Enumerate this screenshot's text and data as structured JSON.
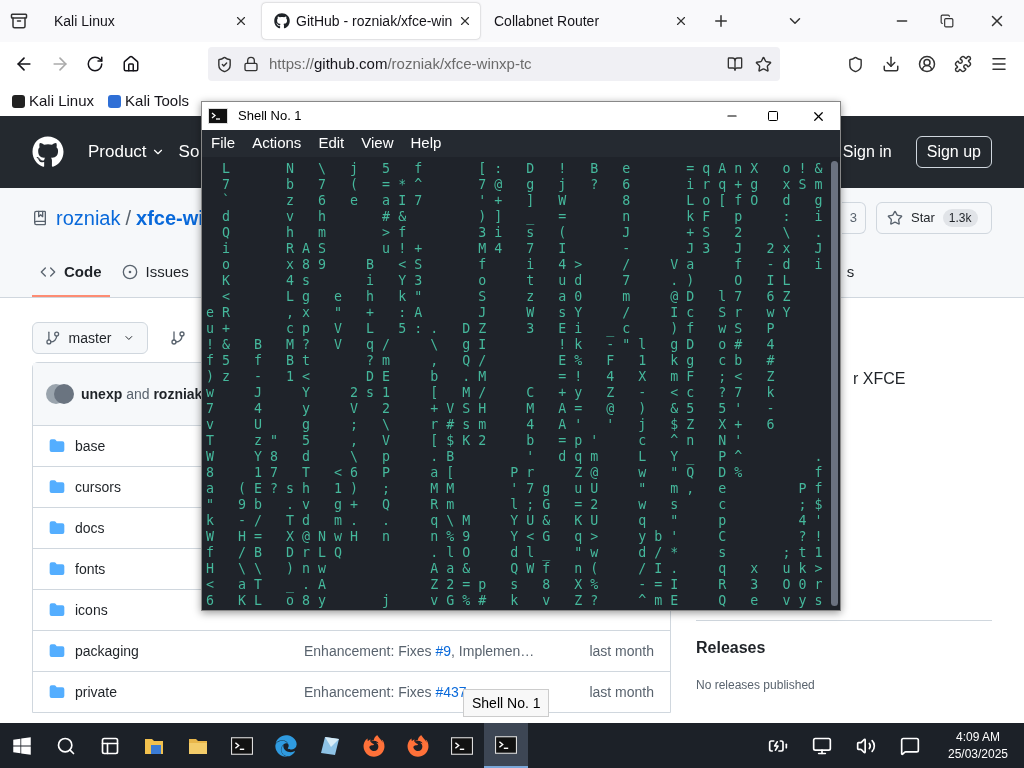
{
  "browser": {
    "tabs": [
      {
        "title": "Kali Linux",
        "selected": false,
        "kind": "plain"
      },
      {
        "title": "GitHub - rozniak/xfce-win",
        "selected": true,
        "kind": "github"
      },
      {
        "title": "Collabnet Router",
        "selected": false,
        "kind": "plain"
      }
    ],
    "url": {
      "scheme": "https://",
      "host": "github.com",
      "path": "/rozniak/xfce-winxp-tc"
    },
    "bookmarks": [
      {
        "title": "Kali Linux",
        "color": "#222222"
      },
      {
        "title": "Kali Tools",
        "color": "#2f6fd6"
      }
    ]
  },
  "github": {
    "nav": [
      "Product",
      "So"
    ],
    "sign_in": "Sign in",
    "sign_up": "Sign up",
    "owner": "rozniak",
    "separator": "/",
    "repo": "xfce-wi",
    "fork_count": "3",
    "star": "Star",
    "star_count": "1.3k",
    "tabs": [
      {
        "label": "Code",
        "selected": true,
        "kind": "code"
      },
      {
        "label": "Issues",
        "selected": false,
        "kind": "issues"
      },
      {
        "label": "s",
        "selected": false,
        "kind": "plain"
      }
    ],
    "branch": "master",
    "commit": {
      "author": "unexp",
      "joiner": "and",
      "coauthor": "rozniak"
    },
    "files": [
      {
        "name": "base"
      },
      {
        "name": "cursors"
      },
      {
        "name": "docs"
      },
      {
        "name": "fonts"
      },
      {
        "name": "icons"
      },
      {
        "name": "packaging",
        "message": "Enhancement: Fixes ",
        "issue": "#9",
        "message_end": ", Implemen…",
        "time": "last month"
      },
      {
        "name": "private",
        "message": "Enhancement: Fixes ",
        "issue": "#437",
        "time": "last month"
      }
    ],
    "about_fragment": "r XFCE",
    "releases": {
      "title": "Releases",
      "empty": "No releases published"
    }
  },
  "terminal": {
    "title": "Shell No. 1",
    "menu": [
      "File",
      "Actions",
      "Edit",
      "View",
      "Help"
    ],
    "lines": [
      "  L       N   \\   j   5   f       [ :   D   !   B   e       = q A n X   o ! &",
      "  7       b   7   (   = * ^       7 @   g   j   ?   6       i r q + g   x S m",
      "  `       z   6   e   a I 7       ' +   ]   W       8       L o [ f O   d   g",
      "  d       v   h       # &         ) ]   _   =       n       k F   p     :   i",
      "  Q       h   m       > f         3 i   s   (       J       + S   2     \\   .",
      "  i       R A S       u ! +       M 4   7   I       -       J 3   J   2 x   J",
      "  o       x 8 9     B   < S       f     i   4 >     /     V a     f   - d   i",
      "  K       4 s       i   Y 3       o     t   u d     7     . )     O   I L",
      "  <       L g   e   h   k \"       S     z   a 0     m     @ D   l 7   6 Z",
      "e R       , x   \"   +   : A       J     W   s Y     /     I c   S r   w Y",
      "u +       c p   V   L   5 : .   D Z     3   E i   _ c     ) f   w S   P",
      "! &   B   M ?   V   q /     \\   g I         ! k   - \" l   g D   o #   4",
      "f 5   f   B t       ? m     ,   Q /         E %   F   1   k g   c b   #",
      ") z   -   1 <       D E     b   . M         = !   4   X   m F   ; <   Z",
      "w     J     Y     2 s 1     [   M /     C   + y   Z   -   < c   ? 7   k",
      "7     4     y     V   2     + V S H     M   A =   @   )   & 5   5 '   -",
      "v     U     g     ;   \\     r # s m     4   A '   '   j   $ Z   X +   6",
      "T     z \"   5     ,   V     [ $ K 2     b   = p '     c   ^ n   N '",
      "W     Y 8   d     \\   p     . B         '   d q m     L   Y _   P ^         .",
      "8     1 7   T   < 6   P     a [       P r     Z @     w   \" Q   D %         f",
      "a   ( E ? s h   1 )   ;     M M       ' 7 g   u U     \"   m ,   e         P f",
      "\"   9 b   . v   g +   Q     R m       l ; G   = 2     w   s     c         ; $",
      "k   - /   T d   m .   .     q \\ M     Y U &   K U     q   \"     p         4 '",
      "W   H =   X @ N w H   n     n % 9     Y < G   q >     y b '     C         ? !",
      "f   / B   D r L Q           . l O     d l _   \" w     d / *     s       ; t 1",
      "H   \\ \\   ) n w             A a &     Q W f   n (     / I .     q   x   u k >",
      "<   a T   _ . A             Z 2 = p   s   8   X %     - = I     R   3   O 0 r",
      "6   K L   o 8 y       j     v G % #   k   v   Z ?     ^ m E     Q   e   v y s"
    ]
  },
  "tooltip": "Shell No. 1",
  "taskbar": {
    "items": [
      {
        "kind": "start",
        "selected": false
      },
      {
        "kind": "search",
        "selected": false
      },
      {
        "kind": "task-view",
        "selected": false
      },
      {
        "kind": "file-explorer",
        "selected": false
      },
      {
        "kind": "folder",
        "selected": false
      },
      {
        "kind": "terminal",
        "selected": false
      },
      {
        "kind": "edge",
        "selected": false
      },
      {
        "kind": "app",
        "selected": false
      },
      {
        "kind": "firefox",
        "selected": false
      },
      {
        "kind": "firefox",
        "selected": false
      },
      {
        "kind": "terminal",
        "selected": false
      },
      {
        "kind": "terminal",
        "selected": true
      }
    ],
    "time": "4:09 AM",
    "date": "25/03/2025"
  }
}
